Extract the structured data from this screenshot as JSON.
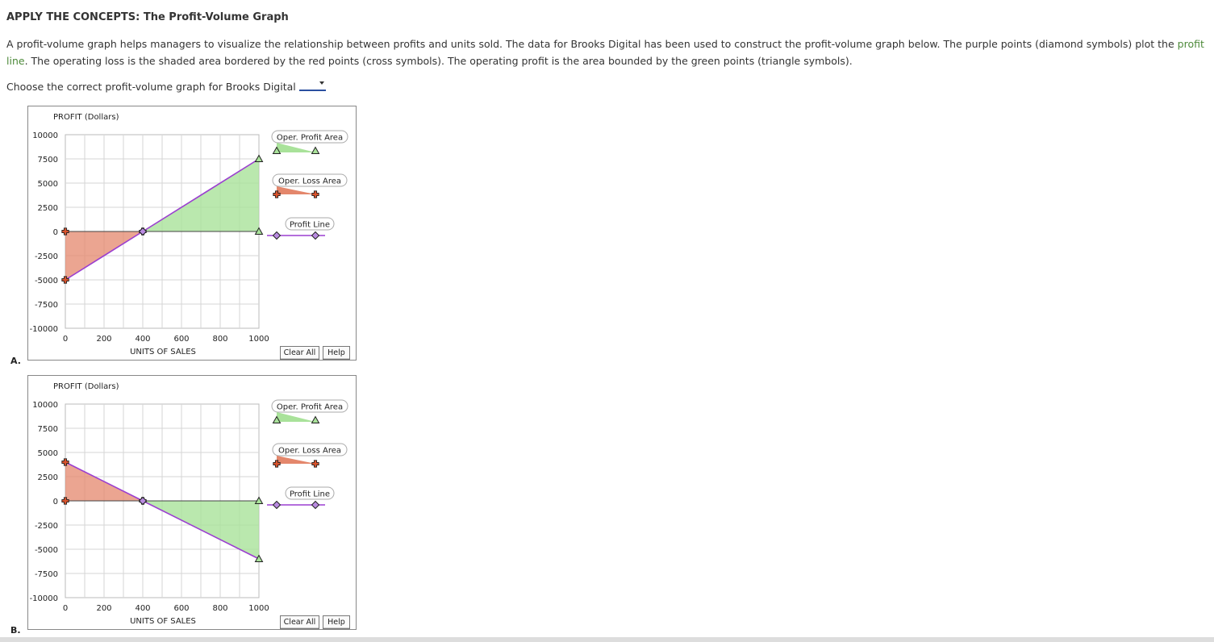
{
  "title": "APPLY THE CONCEPTS: The Profit-Volume Graph",
  "intro": {
    "before_link": "A profit-volume graph helps managers to visualize the relationship between profits and units sold. The data for Brooks Digital has been used to construct the profit-volume graph below. The purple points (diamond symbols) plot the ",
    "link": "profit line",
    "after_link": ". The operating loss is the shaded area bordered by the red points (cross symbols). The operating profit is the area bounded by the green points (triangle symbols)."
  },
  "question": {
    "prompt": "Choose the correct profit-volume graph for Brooks Digital",
    "selected": ""
  },
  "colors": {
    "profit_area": "#a9e29a",
    "loss_area": "#e4876c",
    "profit_line": "#9b3fd0",
    "grid": "#d6d6d6",
    "link": "#4d8a3a"
  },
  "options": [
    {
      "letter": "A.",
      "y_axis_title": "PROFIT (Dollars)",
      "x_axis_title": "UNITS OF SALES",
      "legend": {
        "profit_area": "Oper. Profit Area",
        "loss_area": "Oper. Loss Area",
        "profit_line": "Profit Line"
      },
      "buttons": {
        "clear": "Clear All",
        "help": "Help"
      },
      "chart_data": {
        "type": "area",
        "x_ticks": [
          "0",
          "200",
          "400",
          "600",
          "800",
          "1000"
        ],
        "y_ticks": [
          "10000",
          "7500",
          "5000",
          "2500",
          "0",
          "-2500",
          "-5000",
          "-7500",
          "-10000"
        ],
        "xlim": [
          0,
          1000
        ],
        "ylim": [
          -10000,
          10000
        ],
        "profit_line": [
          [
            0,
            -5000
          ],
          [
            400,
            0
          ],
          [
            1000,
            7500
          ]
        ],
        "loss_area": [
          [
            0,
            0
          ],
          [
            0,
            -5000
          ],
          [
            400,
            0
          ]
        ],
        "profit_area": [
          [
            400,
            0
          ],
          [
            1000,
            7500
          ],
          [
            1000,
            0
          ]
        ]
      }
    },
    {
      "letter": "B.",
      "y_axis_title": "PROFIT (Dollars)",
      "x_axis_title": "UNITS OF SALES",
      "legend": {
        "profit_area": "Oper. Profit Area",
        "loss_area": "Oper. Loss Area",
        "profit_line": "Profit Line"
      },
      "buttons": {
        "clear": "Clear All",
        "help": "Help"
      },
      "chart_data": {
        "type": "area",
        "x_ticks": [
          "0",
          "200",
          "400",
          "600",
          "800",
          "1000"
        ],
        "y_ticks": [
          "10000",
          "7500",
          "5000",
          "2500",
          "0",
          "-2500",
          "-5000",
          "-7500",
          "-10000"
        ],
        "xlim": [
          0,
          1000
        ],
        "ylim": [
          -10000,
          10000
        ],
        "profit_line": [
          [
            0,
            4000
          ],
          [
            400,
            0
          ],
          [
            1000,
            -6000
          ]
        ],
        "loss_area": [
          [
            0,
            4000
          ],
          [
            0,
            0
          ],
          [
            400,
            0
          ]
        ],
        "profit_area": [
          [
            400,
            0
          ],
          [
            1000,
            0
          ],
          [
            1000,
            -6000
          ]
        ]
      }
    }
  ]
}
